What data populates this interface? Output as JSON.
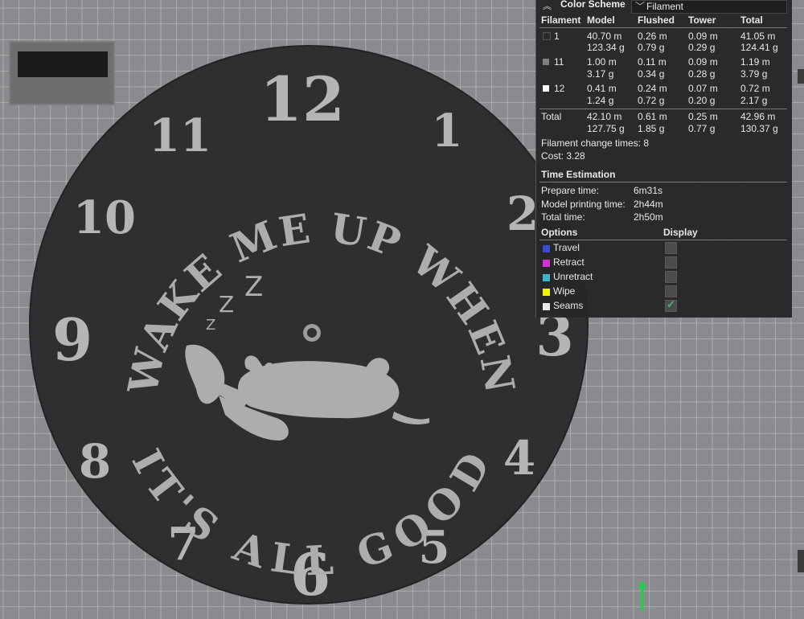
{
  "colors": {
    "plate": "#8a8b8e",
    "grid": "#b9babc",
    "disk": "#2e2f31",
    "print": "#b5b5b5",
    "axis_green": "#19d14a",
    "travel": "#3d4ccf",
    "retract": "#d62fd6",
    "unretract": "#3fb2cf",
    "wipe": "#f2f200",
    "seams": "#eaeaea",
    "filament_1": "#2b2b2b",
    "filament_11": "#808080",
    "filament_12": "#ffffff"
  },
  "scene": {
    "clock_numbers": [
      "12",
      "1",
      "2",
      "3",
      "4",
      "5",
      "6",
      "7",
      "8",
      "9",
      "10",
      "11"
    ],
    "top_arc_text": "WAKE ME UP WHEN",
    "bottom_arc_text": "IT'S ALL GOOD",
    "zzz": [
      "Z",
      "Z",
      "Z"
    ]
  },
  "panel": {
    "color_scheme_label": "Color Scheme",
    "color_scheme_value": "Filament",
    "chevron_icon": "double-chevron-up-icon",
    "headers": [
      "Filament",
      "Model",
      "Flushed",
      "Tower",
      "Total"
    ],
    "filaments": [
      {
        "id": "1",
        "model_m": "40.70 m",
        "model_g": "123.34 g",
        "flushed_m": "0.26 m",
        "flushed_g": "0.79 g",
        "tower_m": "0.09 m",
        "tower_g": "0.29 g",
        "total_m": "41.05 m",
        "total_g": "124.41 g"
      },
      {
        "id": "11",
        "model_m": "1.00 m",
        "model_g": "3.17 g",
        "flushed_m": "0.11 m",
        "flushed_g": "0.34 g",
        "tower_m": "0.09 m",
        "tower_g": "0.28 g",
        "total_m": "1.19 m",
        "total_g": "3.79 g"
      },
      {
        "id": "12",
        "model_m": "0.41 m",
        "model_g": "1.24 g",
        "flushed_m": "0.24 m",
        "flushed_g": "0.72 g",
        "tower_m": "0.07 m",
        "tower_g": "0.20 g",
        "total_m": "0.72 m",
        "total_g": "2.17 g"
      }
    ],
    "total": {
      "label": "Total",
      "model_m": "42.10 m",
      "model_g": "127.75 g",
      "flushed_m": "0.61 m",
      "flushed_g": "1.85 g",
      "tower_m": "0.25 m",
      "tower_g": "0.77 g",
      "total_m": "42.96 m",
      "total_g": "130.37 g"
    },
    "filament_change": "Filament change times:  8",
    "cost": "Cost:  3.28",
    "time_title": "Time Estimation",
    "times": [
      {
        "label": "Prepare time:",
        "value": "6m31s"
      },
      {
        "label": "Model printing time:",
        "value": "2h44m"
      },
      {
        "label": "Total time:",
        "value": "2h50m"
      }
    ],
    "options_header": "Options",
    "display_header": "Display",
    "options": [
      {
        "label": "Travel",
        "checked": false
      },
      {
        "label": "Retract",
        "checked": false
      },
      {
        "label": "Unretract",
        "checked": false
      },
      {
        "label": "Wipe",
        "checked": false
      },
      {
        "label": "Seams",
        "checked": true
      }
    ],
    "check_glyph": "✓"
  }
}
